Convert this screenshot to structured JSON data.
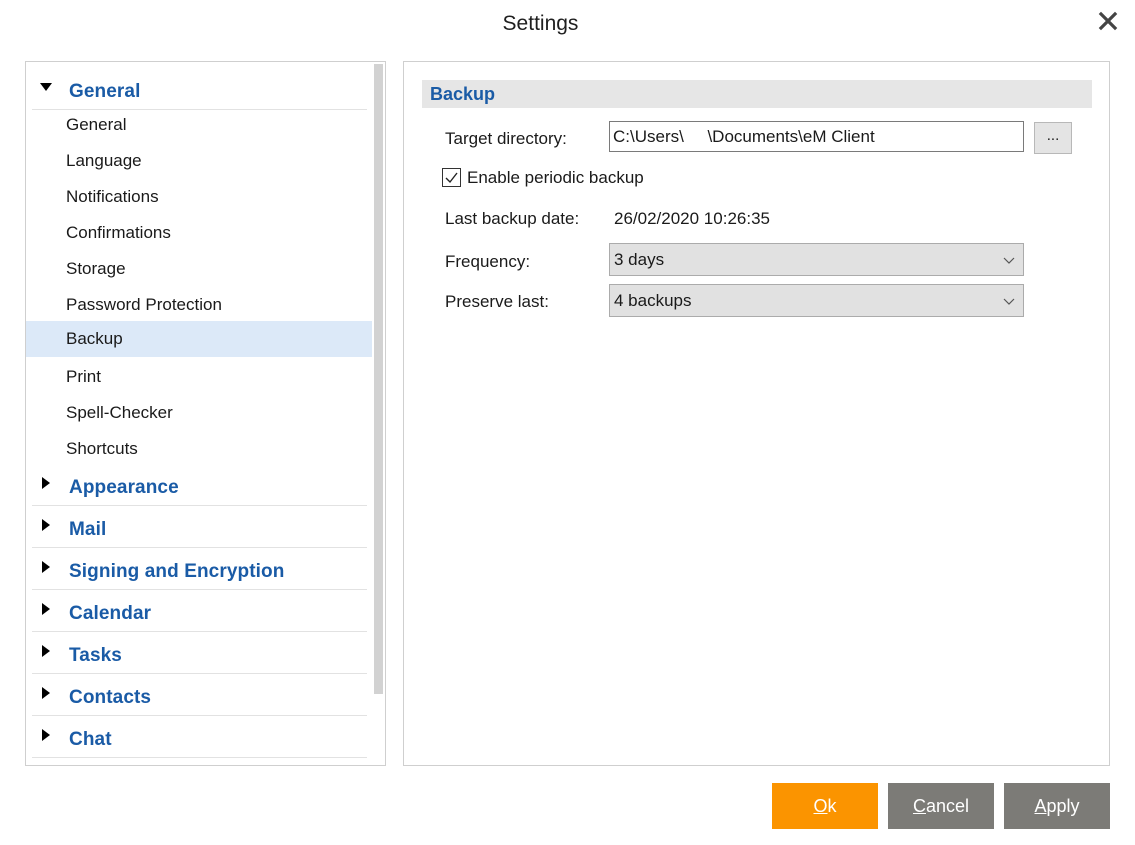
{
  "window": {
    "title": "Settings",
    "close_icon": "close-icon"
  },
  "sidebar": {
    "groups": [
      {
        "label": "General",
        "expanded": true,
        "items": [
          {
            "label": "General"
          },
          {
            "label": "Language"
          },
          {
            "label": "Notifications"
          },
          {
            "label": "Confirmations"
          },
          {
            "label": "Storage"
          },
          {
            "label": "Password Protection"
          },
          {
            "label": "Backup",
            "selected": true
          },
          {
            "label": "Print"
          },
          {
            "label": "Spell-Checker"
          },
          {
            "label": "Shortcuts"
          }
        ]
      },
      {
        "label": "Appearance",
        "expanded": false
      },
      {
        "label": "Mail",
        "expanded": false
      },
      {
        "label": "Signing and Encryption",
        "expanded": false
      },
      {
        "label": "Calendar",
        "expanded": false
      },
      {
        "label": "Tasks",
        "expanded": false
      },
      {
        "label": "Contacts",
        "expanded": false
      },
      {
        "label": "Chat",
        "expanded": false
      }
    ]
  },
  "panel": {
    "section_title": "Backup",
    "target_directory": {
      "label": "Target directory:",
      "value": "C:\\Users\\     \\Documents\\eM Client",
      "browse_label": "..."
    },
    "periodic_backup": {
      "label": "Enable periodic backup",
      "checked": true
    },
    "last_backup": {
      "label": "Last backup date:",
      "value": "26/02/2020 10:26:35"
    },
    "frequency": {
      "label": "Frequency:",
      "value": "3 days"
    },
    "preserve_last": {
      "label": "Preserve last:",
      "value": "4 backups"
    }
  },
  "footer": {
    "ok": {
      "accel": "O",
      "rest": "k",
      "color": "#fb9400"
    },
    "cancel": {
      "accel": "C",
      "rest": "ancel",
      "color": "#7c7b77"
    },
    "apply": {
      "accel": "A",
      "rest": "pply",
      "color": "#7c7b77"
    }
  }
}
